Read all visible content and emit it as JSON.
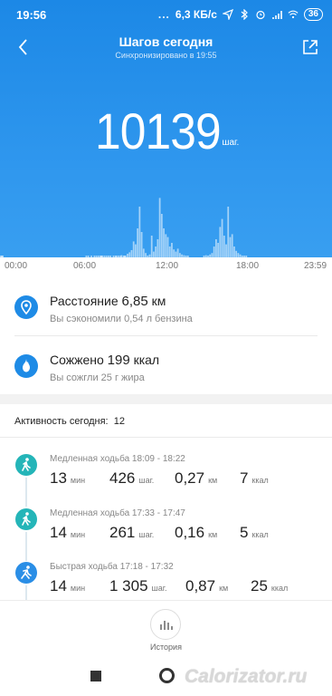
{
  "status_bar": {
    "time": "19:56",
    "dots": "...",
    "speed": "6,3 КБ/с",
    "battery": "36"
  },
  "nav": {
    "title": "Шагов сегодня",
    "subtitle": "Синхронизировано в 19:55"
  },
  "steps": {
    "value": "10139",
    "unit": "шаг."
  },
  "chart_data": {
    "type": "bar",
    "x_ticks": [
      "00:00",
      "06:00",
      "12:00",
      "18:00",
      "23:59"
    ],
    "y_max": 1000,
    "values": [
      5,
      4,
      2,
      0,
      0,
      0,
      0,
      0,
      0,
      0,
      0,
      0,
      0,
      0,
      0,
      0,
      0,
      0,
      0,
      0,
      0,
      0,
      0,
      0,
      0,
      0,
      0,
      0,
      0,
      0,
      0,
      0,
      0,
      0,
      0,
      0,
      0,
      0,
      0,
      0,
      0,
      0,
      0,
      0,
      0,
      0,
      0,
      0,
      0,
      0,
      0,
      0,
      0,
      0,
      0,
      0,
      0,
      0,
      0,
      0,
      0,
      0,
      0,
      0,
      0,
      0,
      0,
      0,
      0,
      0,
      0,
      0,
      0,
      0,
      0,
      0,
      0,
      0,
      0,
      0,
      0,
      0,
      0,
      0,
      0,
      3,
      0,
      5,
      0,
      0,
      6,
      0,
      0,
      4,
      0,
      8,
      0,
      10,
      0,
      12,
      6,
      10,
      0,
      8,
      0,
      15,
      0,
      25,
      0,
      18,
      0,
      0,
      20,
      0,
      15,
      10,
      0,
      12,
      0,
      8,
      30,
      0,
      14,
      5,
      20,
      0,
      50,
      0,
      70,
      0,
      100,
      0,
      220,
      0,
      180,
      0,
      400,
      0,
      700,
      0,
      350,
      0,
      120,
      0,
      60,
      0,
      25,
      0,
      40,
      0,
      300,
      0,
      80,
      0,
      150,
      0,
      250,
      0,
      820,
      0,
      600,
      0,
      400,
      0,
      320,
      0,
      280,
      0,
      150,
      0,
      200,
      0,
      110,
      0,
      80,
      0,
      120,
      0,
      60,
      0,
      40,
      0,
      30,
      0,
      10,
      0,
      5,
      0,
      0,
      0,
      0,
      0,
      0,
      0,
      0,
      0,
      0,
      0,
      0,
      0,
      0,
      0,
      10,
      0,
      30,
      0,
      20,
      0,
      40,
      0,
      60,
      0,
      150,
      0,
      250,
      0,
      200,
      0,
      420,
      0,
      530,
      0,
      300,
      0,
      180,
      0,
      700,
      0,
      280,
      0,
      320,
      0,
      150,
      0,
      90,
      0,
      60,
      0,
      40,
      0,
      20,
      0,
      10,
      0,
      5,
      0,
      0,
      0,
      0,
      0,
      0,
      0,
      0,
      0,
      0,
      0,
      0,
      0,
      0,
      0,
      0,
      0,
      0,
      0,
      0,
      0,
      0,
      0,
      0,
      0,
      0,
      0,
      0,
      0,
      0,
      0,
      0,
      0,
      0,
      0,
      0,
      0,
      0,
      0,
      0,
      0,
      0,
      0,
      0,
      0,
      0,
      0,
      0,
      0,
      0,
      0,
      0,
      0,
      0,
      0,
      0,
      0,
      0,
      0,
      0,
      0,
      0,
      0,
      0,
      0,
      0,
      0,
      0,
      0,
      0,
      0,
      0,
      0,
      0,
      0,
      0,
      0,
      0,
      0,
      0,
      0,
      0,
      0,
      0,
      0
    ],
    "xlabel": "",
    "ylabel": ""
  },
  "metrics": [
    {
      "title_prefix": "Расстояние ",
      "value": "6,85",
      "unit": " км",
      "subtitle": "Вы сэкономили 0,54 л бензина",
      "icon": "location-pin-icon"
    },
    {
      "title_prefix": "Сожжено ",
      "value": "199",
      "unit": " ккал",
      "subtitle": "Вы сожгли 25 г жира",
      "icon": "flame-icon"
    }
  ],
  "activity": {
    "heading": "Активность сегодня:",
    "count": "12",
    "items": [
      {
        "label": "Медленная ходьба 18:09 - 18:22",
        "minutes": "13",
        "min_unit": "мин",
        "steps": "426",
        "steps_unit": "шаг.",
        "km": "0,27",
        "km_unit": "км",
        "kcal": "7",
        "kcal_unit": "ккал",
        "icon_color": "#24b5b8"
      },
      {
        "label": "Медленная ходьба 17:33 - 17:47",
        "minutes": "14",
        "min_unit": "мин",
        "steps": "261",
        "steps_unit": "шаг.",
        "km": "0,16",
        "km_unit": "км",
        "kcal": "5",
        "kcal_unit": "ккал",
        "icon_color": "#24b5b8"
      },
      {
        "label": "Быстрая ходьба 17:18 - 17:32",
        "minutes": "14",
        "min_unit": "мин",
        "steps": "1 305",
        "steps_unit": "шаг.",
        "km": "0,87",
        "km_unit": "км",
        "kcal": "25",
        "kcal_unit": "ккал",
        "icon_color": "#2a8ee6"
      }
    ]
  },
  "bottom": {
    "history_label": "История"
  },
  "watermark": "Calorizator.ru",
  "colors": {
    "hero": "#2f97ee",
    "accent": "#1e8be6",
    "walk_slow": "#24b5b8"
  }
}
